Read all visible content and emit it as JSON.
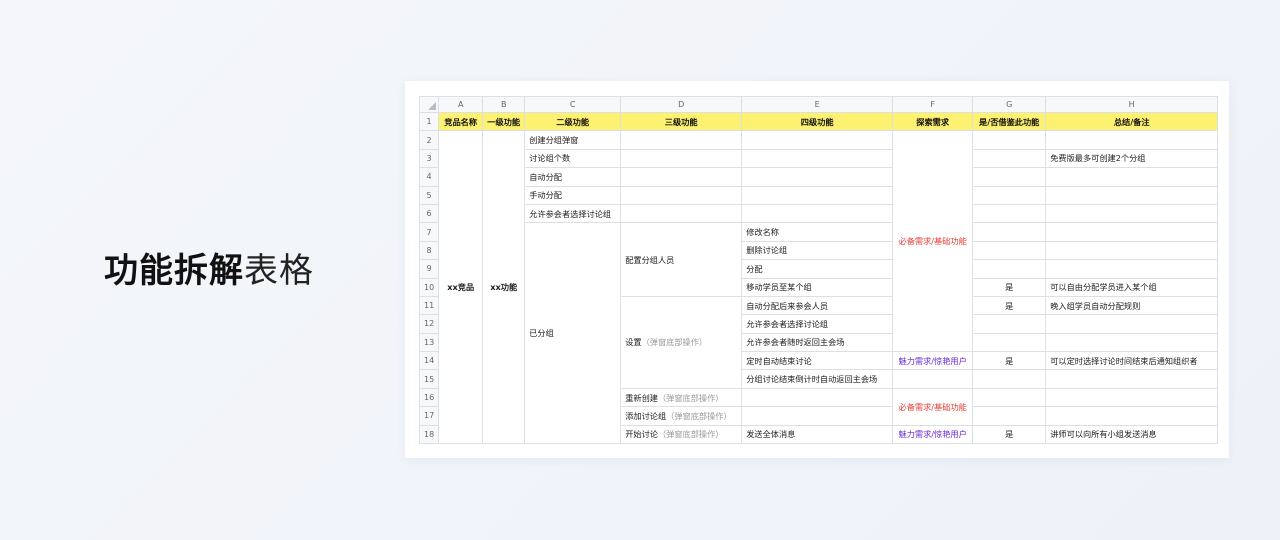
{
  "title": {
    "bold": "功能拆解",
    "light": "表格"
  },
  "sheet": {
    "col_letters": [
      "A",
      "B",
      "C",
      "D",
      "E",
      "F",
      "G",
      "H"
    ],
    "headers": [
      "竞品名称",
      "一级功能",
      "二级功能",
      "三级功能",
      "四级功能",
      "探索需求",
      "是/否借鉴此功能",
      "总结/备注"
    ],
    "row_numbers": [
      "1",
      "2",
      "3",
      "4",
      "5",
      "6",
      "7",
      "8",
      "9",
      "10",
      "11",
      "12",
      "13",
      "14",
      "15",
      "16",
      "17",
      "18"
    ],
    "competitor": "xx竞品",
    "level1": "xx功能",
    "level2": {
      "create_popup": "创建分组弹窗",
      "group_count": "讨论组个数",
      "auto_assign": "自动分配",
      "manual_assign": "手动分配",
      "allow_choose": "允许参会者选择讨论组",
      "grouped": "已分组"
    },
    "level3": {
      "config_members": "配置分组人员",
      "settings": "设置",
      "settings_note": "（弹窗底部操作）",
      "recreate": "重新创建",
      "recreate_note": "（弹窗底部操作）",
      "add_group": "添加讨论组",
      "add_group_note": "（弹窗底部操作）",
      "start": "开始讨论",
      "start_note": "（弹窗底部操作）"
    },
    "level4": {
      "rename": "修改名称",
      "delete_group": "删除讨论组",
      "assign": "分配",
      "move_member": "移动学员至某个组",
      "auto_assign_late": "自动分配后来参会人员",
      "allow_choose": "允许参会者选择讨论组",
      "allow_return": "允许参会者随时返回主会场",
      "timed_end": "定时自动结束讨论",
      "countdown_return": "分组讨论结束倒计时自动返回主会场",
      "broadcast": "发送全体消息"
    },
    "explore": {
      "must_basic": "必备需求/基础功能",
      "charm_delight": "魅力需求/惊艳用户"
    },
    "yes": "是",
    "notes": {
      "r3": "免费版最多可创建2个分组",
      "r10": "可以自由分配学员进入某个组",
      "r11": "晚入组学员自动分配规则",
      "r14": "可以定时选择讨论时间结束后通知组织者",
      "r18": "讲师可以向所有小组发送消息"
    },
    "colors": {
      "header_bg": "#fdf171",
      "must_text": "#e8413a",
      "charm_text": "#6a2fd6"
    }
  }
}
